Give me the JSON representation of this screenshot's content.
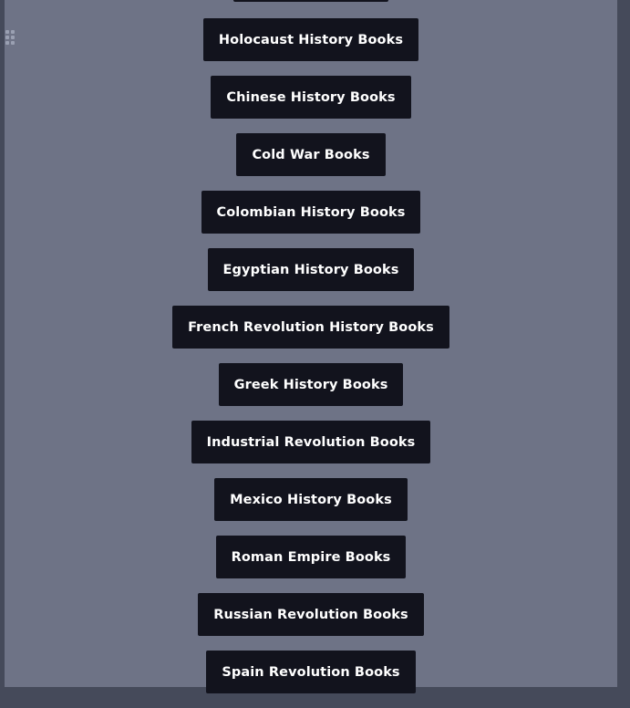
{
  "drag_handle_icon": "drag-handle-icon",
  "colors": {
    "panel": "#6e7386",
    "frame": "#454a5a",
    "button_bg": "#12131d",
    "button_text": "#ffffff"
  },
  "buttons": [
    {
      "label": ""
    },
    {
      "label": "Holocaust History Books"
    },
    {
      "label": "Chinese History Books"
    },
    {
      "label": "Cold War Books"
    },
    {
      "label": "Colombian History Books"
    },
    {
      "label": "Egyptian History Books"
    },
    {
      "label": "French Revolution History Books"
    },
    {
      "label": "Greek History Books"
    },
    {
      "label": "Industrial Revolution Books"
    },
    {
      "label": "Mexico History Books"
    },
    {
      "label": "Roman Empire Books"
    },
    {
      "label": "Russian Revolution Books"
    },
    {
      "label": "Spain Revolution Books"
    }
  ]
}
